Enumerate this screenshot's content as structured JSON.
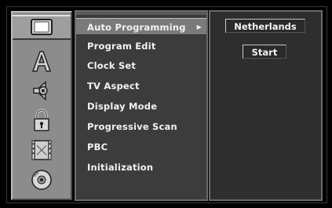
{
  "sidebar": {
    "tabs": [
      {
        "name": "tv-setup-icon",
        "active": true
      },
      {
        "name": "language-icon",
        "active": false
      },
      {
        "name": "audio-icon",
        "active": false
      },
      {
        "name": "lock-icon",
        "active": false
      },
      {
        "name": "record-icon",
        "active": false
      },
      {
        "name": "disc-icon",
        "active": false
      }
    ]
  },
  "menu": {
    "items": [
      {
        "label": "Auto Programming",
        "active": true
      },
      {
        "label": "Program Edit",
        "active": false
      },
      {
        "label": "Clock Set",
        "active": false
      },
      {
        "label": "TV Aspect",
        "active": false
      },
      {
        "label": "Display Mode",
        "active": false
      },
      {
        "label": "Progressive Scan",
        "active": false
      },
      {
        "label": "PBC",
        "active": false
      },
      {
        "label": "Initialization",
        "active": false
      }
    ],
    "arrow": "▶"
  },
  "options": {
    "country": "Netherlands",
    "start": "Start"
  },
  "colors": {
    "sidebar_bg": "#8c8c8c",
    "menu_bg": "#3c3c3c",
    "menu_active": "#7a7a7a",
    "options_bg": "#2e2e2e"
  }
}
